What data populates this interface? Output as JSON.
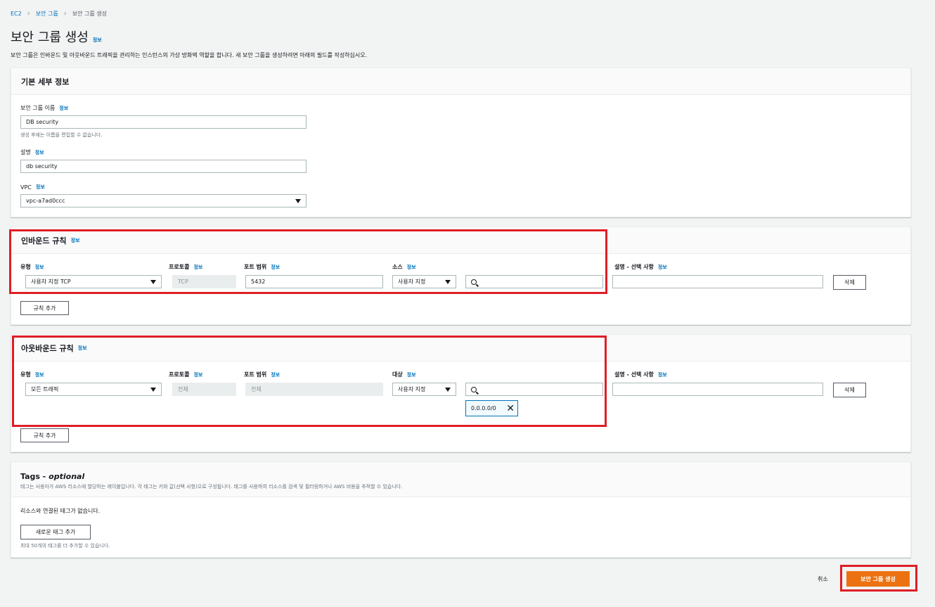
{
  "breadcrumb": {
    "items": [
      "EC2",
      "보안 그룹",
      "보안 그룹 생성"
    ]
  },
  "page": {
    "title": "보안 그룹 생성",
    "info": "정보",
    "description": "보안 그룹은 인바운드 및 아웃바운드 트래픽을 관리하는 인스턴스의 가상 방화벽 역할을 합니다. 새 보안 그룹을 생성하려면 아래의 필드를 작성하십시오."
  },
  "basic": {
    "title": "기본 세부 정보",
    "name_label": "보안 그룹 이름",
    "name_value": "DB security",
    "name_hint": "생성 후에는 이름을 편집할 수 없습니다.",
    "desc_label": "설명",
    "desc_value": "db security",
    "vpc_label": "VPC",
    "vpc_value": "vpc-a7ad0ccc"
  },
  "inbound": {
    "title": "인바운드 규칙",
    "col_type": "유형",
    "col_protocol": "프로토콜",
    "col_port": "포트 범위",
    "col_source": "소스",
    "col_desc": "설명 - 선택 사항",
    "type_value": "사용자 지정 TCP",
    "protocol_value": "TCP",
    "port_value": "5432",
    "source_value": "사용자 지정",
    "delete_label": "삭제",
    "add_rule_label": "규칙 추가"
  },
  "outbound": {
    "title": "아웃바운드 규칙",
    "col_type": "유형",
    "col_protocol": "프로토콜",
    "col_port": "포트 범위",
    "col_dest": "대상",
    "col_desc": "설명 - 선택 사항",
    "type_value": "모든 트래픽",
    "protocol_value": "전체",
    "port_value": "전체",
    "dest_value": "사용자 지정",
    "cidr_token": "0.0.0.0/0",
    "delete_label": "삭제",
    "add_rule_label": "규칙 추가"
  },
  "tags": {
    "title": "Tags",
    "title_optional": "- optional",
    "description": "태그는 사용자가 AWS 리소스에 할당하는 레이블입니다. 각 태그는 키와 값(선택 사항)으로 구성됩니다. 태그를 사용하여 리소스를 검색 및 필터링하거나 AWS 비용을 추적할 수 있습니다.",
    "empty": "리소스와 연결된 태그가 없습니다.",
    "add_label": "새로운 태그 추가",
    "limit_hint": "최대 50개의 태그를 더 추가할 수 있습니다."
  },
  "footer": {
    "cancel_label": "취소",
    "create_label": "보안 그룹 생성"
  },
  "colors": {
    "accent": "#ec7211",
    "link": "#0073bb",
    "highlight": "#df1e26"
  }
}
